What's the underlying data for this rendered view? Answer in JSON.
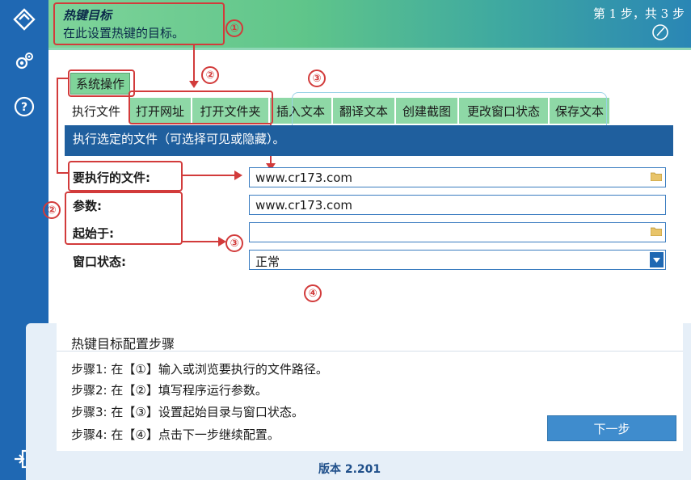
{
  "header": {
    "title": "热键目标",
    "subtitle": "在此设置热键的目标。",
    "steps": "第 1 步，共 3 步"
  },
  "rail": {
    "icons": [
      "layers-icon",
      "gear-icon",
      "help-icon",
      "exit-icon"
    ],
    "help_glyph": "?"
  },
  "annotations": [
    "①",
    "②",
    "③",
    "②",
    "③",
    "④"
  ],
  "tabs": {
    "group": "系统操作",
    "items": [
      "执行文件",
      "打开网址",
      "打开文件夹",
      "插入文本",
      "翻译文本",
      "创建截图",
      "更改窗口状态",
      "保存文本"
    ]
  },
  "description": "执行选定的文件（可选择可见或隐藏）。",
  "form": {
    "file_label": "要执行的文件:",
    "file_value": "www.cr173.com",
    "params_label": "参数:",
    "params_value": "www.cr173.com",
    "start_label": "起始于:",
    "start_value": "",
    "window_label": "窗口状态:",
    "window_value": "正常"
  },
  "guide": {
    "title": "热键目标配置步骤",
    "steps": [
      "步骤1: 在【①】输入或浏览要执行的文件路径。",
      "步骤2: 在【②】填写程序运行参数。",
      "步骤3: 在【③】设置起始目录与窗口状态。",
      "步骤4: 在【④】点击下一步继续配置。"
    ]
  },
  "next_button": "下一步",
  "version": "版本 2.201",
  "colors": {
    "rail": "#1f68b3",
    "accent_red": "#d23b3b",
    "tab_green": "#8ed8a6",
    "desc_bar": "#1f5f9e"
  }
}
